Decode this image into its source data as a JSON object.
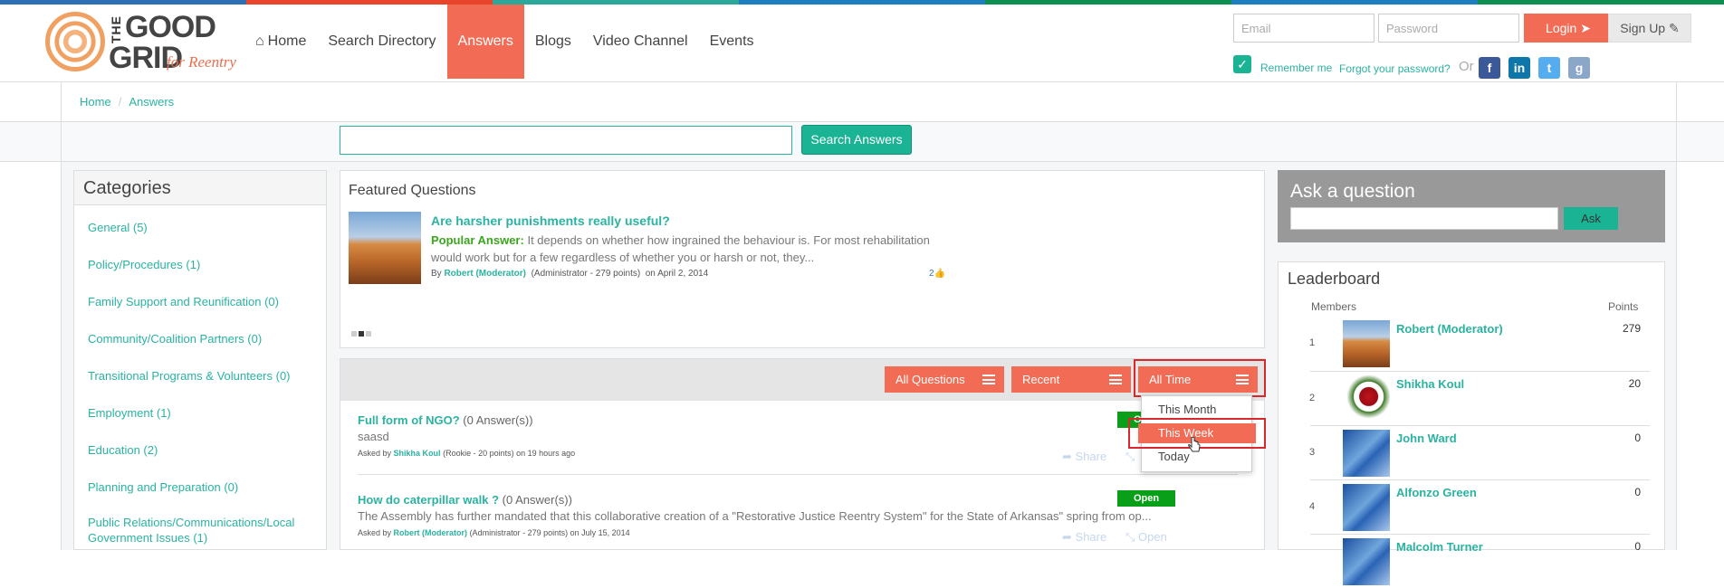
{
  "topbar_colors": [
    "#2c6fb7",
    "#e8452c",
    "#2ba89a",
    "#1b7fc0",
    "#0d8f52"
  ],
  "logo": {
    "the": "THE",
    "good": "GOOD",
    "grid": "GRID",
    "reentry": "for Reentry"
  },
  "nav": {
    "items": [
      "Home",
      "Search Directory",
      "Answers",
      "Blogs",
      "Video Channel",
      "Events"
    ],
    "active": "Answers"
  },
  "auth": {
    "email_placeholder": "Email",
    "password_placeholder": "Password",
    "login_label": "Login",
    "signup_label": "Sign Up",
    "remember_label": "Remember me",
    "forgot_label": "Forgot your password?",
    "or_label": "Or"
  },
  "breadcrumb": {
    "home": "Home",
    "current": "Answers"
  },
  "search": {
    "button_label": "Search Answers",
    "value": ""
  },
  "categories": {
    "title": "Categories",
    "items": [
      "General (5)",
      "Policy/Procedures (1)",
      "Family Support and Reunification (0)",
      "Community/Coalition Partners (0)",
      "Transitional Programs & Volunteers (0)",
      "Employment (1)",
      "Education (2)",
      "Planning and Preparation (0)",
      "Public Relations/Communications/Local Government Issues (1)"
    ]
  },
  "featured": {
    "title": "Featured Questions",
    "question": "Are harsher punishments really useful?",
    "answer_label": "Popular Answer:",
    "answer_text": "It depends on whether how ingrained the behaviour is. For most rehabilitation would work but for a few regardless of whether you or harsh or not, they...",
    "by_prefix": "By",
    "author": "Robert (Moderator)",
    "author_meta": "(Administrator - 279 points)",
    "date": "on April 2, 2014",
    "likes": "2"
  },
  "filters": {
    "all_questions": "All Questions",
    "recent": "Recent",
    "all_time": "All Time"
  },
  "time_dropdown": {
    "items": [
      "This Month",
      "This Week",
      "Today"
    ],
    "highlighted": "This Week"
  },
  "questions": [
    {
      "title": "Full form of NGO?",
      "answers": "(0 Answer(s))",
      "desc": "saasd",
      "asked_prefix": "Asked by",
      "author": "Shikha Koul",
      "meta": "(Rookie - 20 points) on 19 hours ago",
      "status": "Open",
      "share": "Share",
      "open": "Open"
    },
    {
      "title": "How do caterpillar walk ?",
      "answers": "(0 Answer(s))",
      "desc": "The Assembly has further mandated that this collaborative creation of a \"Restorative Justice Reentry System\" for the State of Arkansas\" spring from op...",
      "asked_prefix": "Asked by",
      "author": "Robert (Moderator)",
      "meta": "(Administrator - 279 points) on July 15, 2014",
      "status": "Open",
      "share": "Share",
      "open": "Open"
    }
  ],
  "ask": {
    "title": "Ask a question",
    "button": "Ask",
    "value": ""
  },
  "leaderboard": {
    "title": "Leaderboard",
    "members_label": "Members",
    "points_label": "Points",
    "rows": [
      {
        "rank": "1",
        "name": "Robert (Moderator)",
        "points": "279",
        "avatar": "rock"
      },
      {
        "rank": "2",
        "name": "Shikha Koul",
        "points": "20",
        "avatar": "rose"
      },
      {
        "rank": "3",
        "name": "John Ward",
        "points": "0",
        "avatar": "blue"
      },
      {
        "rank": "4",
        "name": "Alfonzo Green",
        "points": "0",
        "avatar": "blue"
      },
      {
        "rank": "",
        "name": "Malcolm Turner",
        "points": "0",
        "avatar": "blue"
      }
    ]
  },
  "colors": {
    "accent": "#f26b55",
    "teal": "#2ab3a0",
    "highlight_box": "#d9272e",
    "open_badge": "#0a9f18"
  }
}
